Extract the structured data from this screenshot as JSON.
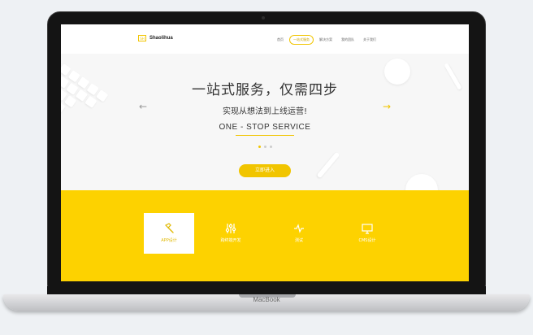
{
  "device": {
    "label": "MacBook"
  },
  "nav": {
    "logo_mark": "SH",
    "logo_text": "Shaolihua",
    "items": [
      {
        "label": "首页",
        "active": false
      },
      {
        "label": "一站式服务",
        "active": true
      },
      {
        "label": "解决方案",
        "active": false
      },
      {
        "label": "我的团队",
        "active": false
      },
      {
        "label": "关于我们",
        "active": false
      }
    ]
  },
  "hero": {
    "title": "一站式服务，仅需四步",
    "subtitle": "实现从想法到上线运营!",
    "english": "ONE - STOP SERVICE",
    "cta": "立即进入",
    "prev_icon": "arrow-left-icon",
    "next_icon": "arrow-right-icon",
    "slides": 3,
    "current_slide": 1
  },
  "services": [
    {
      "label": "APP设计",
      "icon": "hammer-icon",
      "active": true
    },
    {
      "label": "跨终端开发",
      "icon": "sliders-icon",
      "active": false
    },
    {
      "label": "测试",
      "icon": "pulse-icon",
      "active": false
    },
    {
      "label": "CMS设计",
      "icon": "monitor-icon",
      "active": false
    }
  ],
  "colors": {
    "accent": "#fdd200",
    "accent_dark": "#f1c500",
    "text": "#333333"
  }
}
